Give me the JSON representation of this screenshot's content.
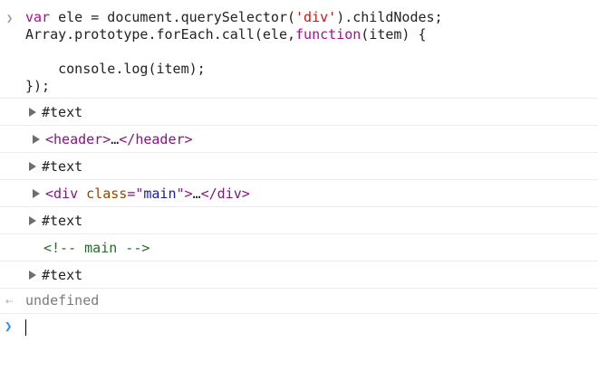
{
  "input": {
    "prompt_icon": "chevron-right-icon",
    "lines": [
      {
        "parts": [
          {
            "cls": "kw",
            "text": "var"
          },
          {
            "cls": "",
            "text": " ele = document.querySelector("
          },
          {
            "cls": "str",
            "text": "'div'"
          },
          {
            "cls": "",
            "text": ").childNodes;"
          }
        ]
      },
      {
        "parts": [
          {
            "cls": "",
            "text": "Array.prototype.forEach.call(ele,"
          },
          {
            "cls": "kw",
            "text": "function"
          },
          {
            "cls": "",
            "text": "(item) {"
          }
        ]
      },
      {
        "parts": [
          {
            "cls": "",
            "text": ""
          }
        ]
      },
      {
        "parts": [
          {
            "cls": "",
            "text": "    console.log(item);"
          }
        ]
      },
      {
        "parts": [
          {
            "cls": "",
            "text": "});"
          }
        ]
      }
    ]
  },
  "outputs": [
    {
      "kind": "text",
      "indent": 32,
      "parts": [
        {
          "cls": "text-node",
          "text": "#text"
        }
      ]
    },
    {
      "kind": "element",
      "indent": 36,
      "parts": [
        {
          "cls": "tag",
          "text": "<header>"
        },
        {
          "cls": "ellipsis",
          "text": "…"
        },
        {
          "cls": "tag",
          "text": "</header>"
        }
      ]
    },
    {
      "kind": "text",
      "indent": 32,
      "parts": [
        {
          "cls": "text-node",
          "text": "#text"
        }
      ]
    },
    {
      "kind": "element",
      "indent": 36,
      "parts": [
        {
          "cls": "tag",
          "text": "<div "
        },
        {
          "cls": "attr-name",
          "text": "class"
        },
        {
          "cls": "tag",
          "text": "=\""
        },
        {
          "cls": "attr-val",
          "text": "main"
        },
        {
          "cls": "tag",
          "text": "\">"
        },
        {
          "cls": "ellipsis",
          "text": "…"
        },
        {
          "cls": "tag",
          "text": "</div>"
        }
      ]
    },
    {
      "kind": "text",
      "indent": 32,
      "parts": [
        {
          "cls": "text-node",
          "text": "#text"
        }
      ]
    },
    {
      "kind": "comment",
      "indent": 48,
      "parts": [
        {
          "cls": "comment",
          "text": "<!-- main -->"
        }
      ]
    },
    {
      "kind": "text",
      "indent": 32,
      "parts": [
        {
          "cls": "text-node",
          "text": "#text"
        }
      ]
    }
  ],
  "result": {
    "icon": "return-arrow-icon",
    "text": "undefined"
  },
  "prompt": {
    "icon": "prompt-caret-icon"
  }
}
